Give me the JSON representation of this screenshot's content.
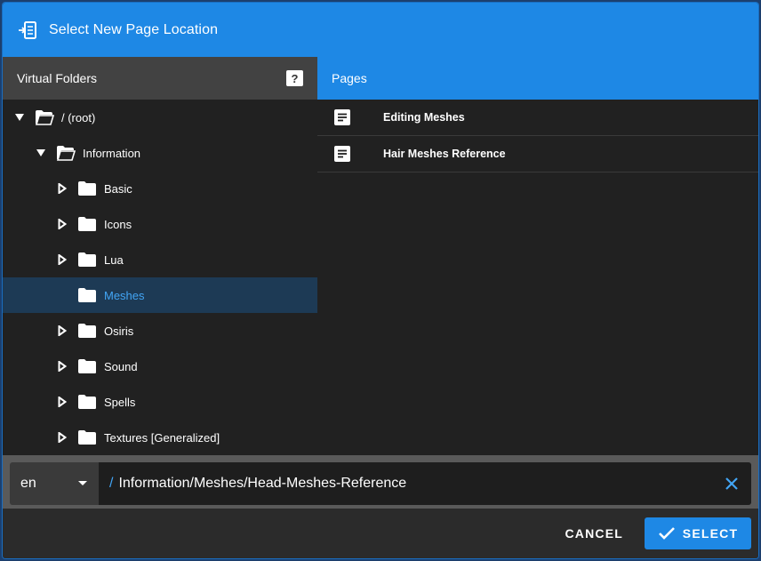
{
  "dialog": {
    "title": "Select New Page Location",
    "title_icon": "page-move-icon"
  },
  "folders_panel": {
    "header": "Virtual Folders",
    "help_label": "?",
    "items": [
      {
        "label": "/ (root)",
        "depth": 0,
        "expanded": true,
        "has_children": true,
        "selected": false
      },
      {
        "label": "Information",
        "depth": 1,
        "expanded": true,
        "has_children": true,
        "selected": false
      },
      {
        "label": "Basic",
        "depth": 2,
        "expanded": false,
        "has_children": true,
        "selected": false
      },
      {
        "label": "Icons",
        "depth": 2,
        "expanded": false,
        "has_children": true,
        "selected": false
      },
      {
        "label": "Lua",
        "depth": 2,
        "expanded": false,
        "has_children": true,
        "selected": false
      },
      {
        "label": "Meshes",
        "depth": 2,
        "expanded": false,
        "has_children": false,
        "selected": true
      },
      {
        "label": "Osiris",
        "depth": 2,
        "expanded": false,
        "has_children": true,
        "selected": false
      },
      {
        "label": "Sound",
        "depth": 2,
        "expanded": false,
        "has_children": true,
        "selected": false
      },
      {
        "label": "Spells",
        "depth": 2,
        "expanded": false,
        "has_children": true,
        "selected": false
      },
      {
        "label": "Textures [Generalized]",
        "depth": 2,
        "expanded": false,
        "has_children": true,
        "selected": false
      }
    ]
  },
  "pages_panel": {
    "header": "Pages",
    "items": [
      {
        "label": "Editing Meshes",
        "icon": "document-icon"
      },
      {
        "label": "Hair Meshes Reference",
        "icon": "document-icon"
      }
    ]
  },
  "path_bar": {
    "locale": "en",
    "slash": "/",
    "path": "Information/Meshes/Head-Meshes-Reference"
  },
  "footer": {
    "cancel_label": "CANCEL",
    "select_label": "SELECT"
  },
  "colors": {
    "accent": "#1e88e5",
    "selected_bg": "#1d3a55",
    "selected_text": "#42a5f5",
    "panel_bg": "#212121",
    "header_bg": "#424242"
  }
}
